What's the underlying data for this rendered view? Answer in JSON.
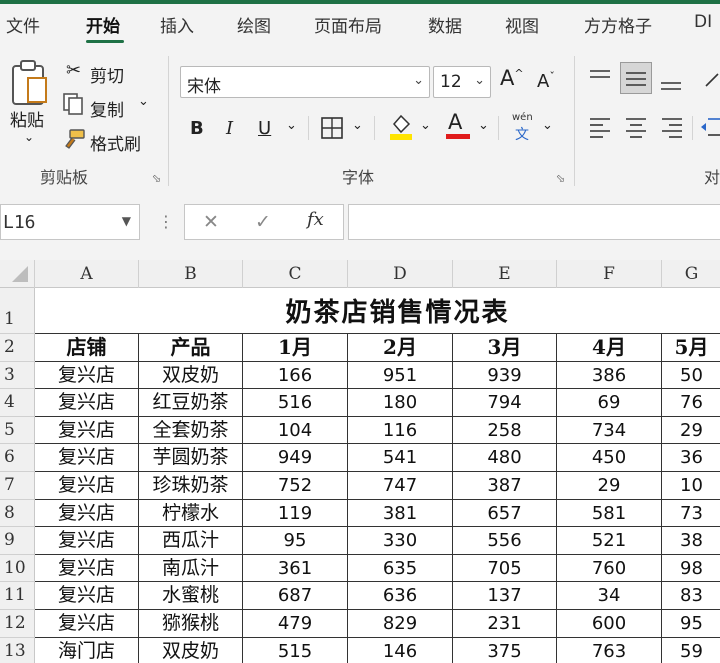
{
  "tabs": [
    "文件",
    "开始",
    "插入",
    "绘图",
    "页面布局",
    "数据",
    "视图",
    "方方格子",
    "DI"
  ],
  "active_tab": "开始",
  "clipboard": {
    "paste_label": "粘贴",
    "cut_label": "剪切",
    "copy_label": "复制",
    "format_painter_label": "格式刷",
    "group_label": "剪贴板"
  },
  "font": {
    "name": "宋体",
    "size": "12",
    "group_label": "字体",
    "bold": "B",
    "italic": "I",
    "underline": "U",
    "pinyin_top": "wén",
    "pinyin_bottom": "文",
    "grow": "A",
    "shrink": "A",
    "color_a": "A",
    "highlight_color": "#ffe400",
    "font_color": "#e01b1b"
  },
  "alignment": {
    "group_label": "对"
  },
  "formula_bar": {
    "name_box": "L16",
    "cancel": "✕",
    "enter": "✓",
    "fx": "fx",
    "value": ""
  },
  "column_headers": [
    "A",
    "B",
    "C",
    "D",
    "E",
    "F",
    "G"
  ],
  "row_headers": [
    "1",
    "2",
    "3",
    "4",
    "5",
    "6",
    "7",
    "8",
    "9",
    "10",
    "11",
    "12",
    "13"
  ],
  "sheet": {
    "title": "奶茶店销售情况表",
    "headers": [
      "店铺",
      "产品",
      "1月",
      "2月",
      "3月",
      "4月",
      "5月"
    ],
    "rows": [
      [
        "复兴店",
        "双皮奶",
        "166",
        "951",
        "939",
        "386",
        "50"
      ],
      [
        "复兴店",
        "红豆奶茶",
        "516",
        "180",
        "794",
        "69",
        "76"
      ],
      [
        "复兴店",
        "全套奶茶",
        "104",
        "116",
        "258",
        "734",
        "29"
      ],
      [
        "复兴店",
        "芋圆奶茶",
        "949",
        "541",
        "480",
        "450",
        "36"
      ],
      [
        "复兴店",
        "珍珠奶茶",
        "752",
        "747",
        "387",
        "29",
        "10"
      ],
      [
        "复兴店",
        "柠檬水",
        "119",
        "381",
        "657",
        "581",
        "73"
      ],
      [
        "复兴店",
        "西瓜汁",
        "95",
        "330",
        "556",
        "521",
        "38"
      ],
      [
        "复兴店",
        "南瓜汁",
        "361",
        "635",
        "705",
        "760",
        "98"
      ],
      [
        "复兴店",
        "水蜜桃",
        "687",
        "636",
        "137",
        "34",
        "83"
      ],
      [
        "复兴店",
        "猕猴桃",
        "479",
        "829",
        "231",
        "600",
        "95"
      ],
      [
        "海门店",
        "双皮奶",
        "515",
        "146",
        "375",
        "763",
        "59"
      ]
    ]
  }
}
